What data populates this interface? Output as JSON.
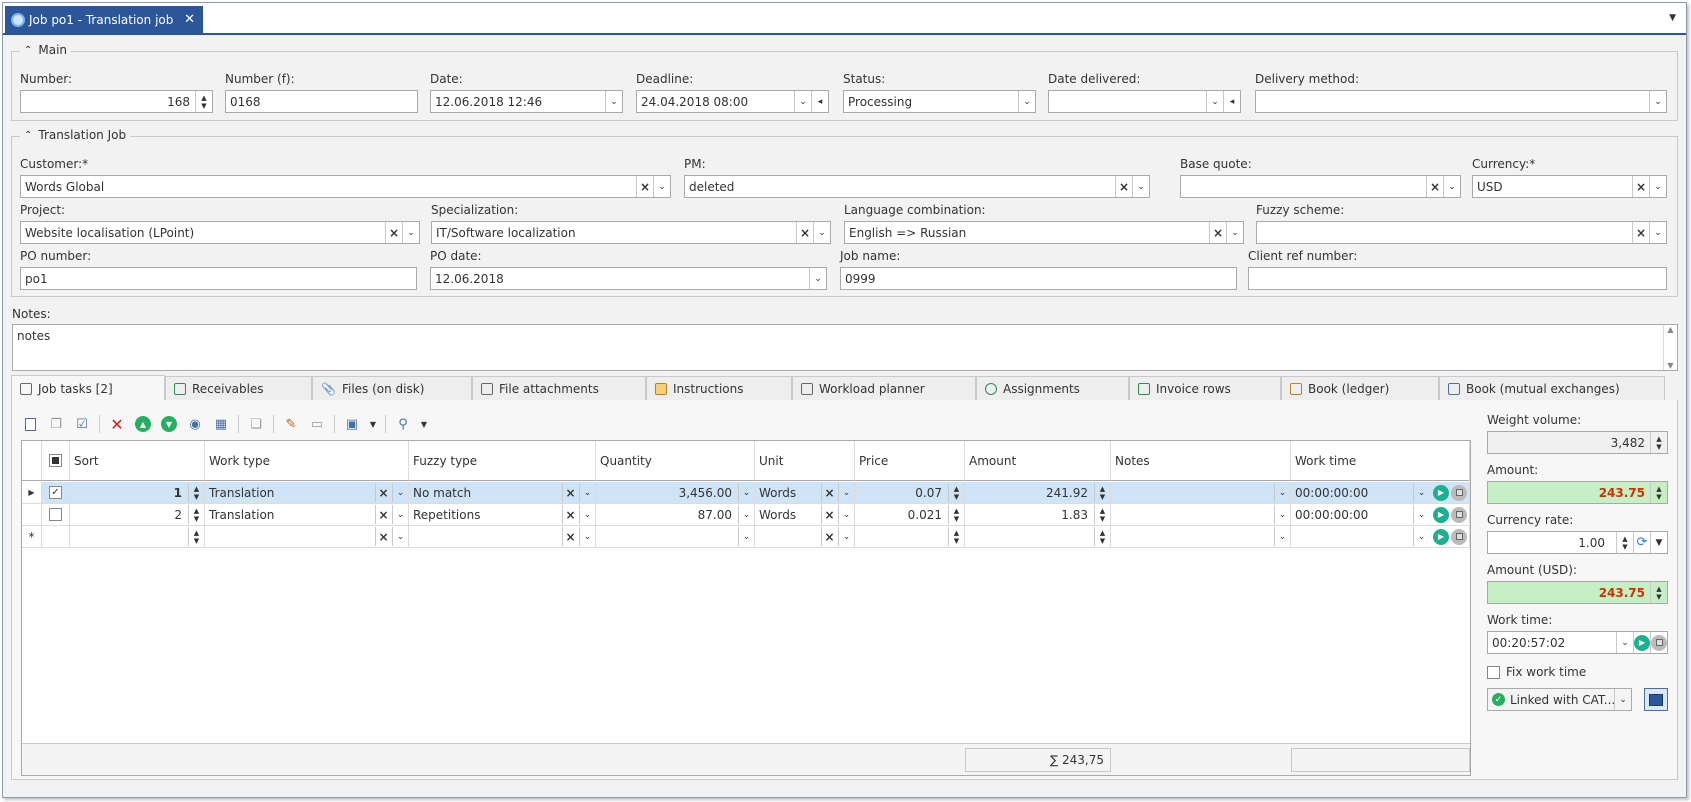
{
  "window": {
    "tab_title": "Job po1 - Translation job",
    "close": "✕"
  },
  "main": {
    "title": "Main",
    "number_label": "Number:",
    "number": "168",
    "number_f_label": "Number (f):",
    "number_f": "0168",
    "date_label": "Date:",
    "date": "12.06.2018 12:46",
    "deadline_label": "Deadline:",
    "deadline": "24.04.2018 08:00",
    "status_label": "Status:",
    "status": "Processing",
    "date_delivered_label": "Date delivered:",
    "date_delivered": "",
    "delivery_method_label": "Delivery method:",
    "delivery_method": ""
  },
  "job": {
    "title": "Translation Job",
    "customer_label": "Customer:*",
    "customer": "Words Global",
    "pm_label": "PM:",
    "pm": "deleted",
    "base_quote_label": "Base quote:",
    "base_quote": "",
    "currency_label": "Currency:*",
    "currency": "USD",
    "project_label": "Project:",
    "project": "Website localisation (LPoint)",
    "specialization_label": "Specialization:",
    "specialization": "IT/Software localization",
    "language_label": "Language combination:",
    "language": "English => Russian",
    "fuzzy_label": "Fuzzy scheme:",
    "fuzzy": "",
    "po_number_label": "PO number:",
    "po_number": "po1",
    "po_date_label": "PO date:",
    "po_date": "12.06.2018",
    "job_name_label": "Job name:",
    "job_name": "0999",
    "client_ref_label": "Client ref number:",
    "client_ref": ""
  },
  "notes": {
    "label": "Notes:",
    "value": "notes"
  },
  "tabs": [
    "Job tasks [2]",
    "Receivables",
    "Files (on disk)",
    "File attachments",
    "Instructions",
    "Workload planner",
    "Assignments",
    "Invoice rows",
    "Book (ledger)",
    "Book (mutual exchanges)"
  ],
  "grid": {
    "headers": [
      "Sort",
      "Work type",
      "Fuzzy type",
      "Quantity",
      "Unit",
      "Price",
      "Amount",
      "Notes",
      "Work time"
    ],
    "rows": [
      {
        "sort": "1",
        "work_type": "Translation",
        "fuzzy_type": "No match",
        "quantity": "3,456.00",
        "unit": "Words",
        "price": "0.07",
        "amount": "241.92",
        "notes": "",
        "work_time": "00:00:00:00"
      },
      {
        "sort": "2",
        "work_type": "Translation",
        "fuzzy_type": "Repetitions",
        "quantity": "87.00",
        "unit": "Words",
        "price": "0.021",
        "amount": "1.83",
        "notes": "",
        "work_time": "00:00:00:00"
      }
    ],
    "new_row_marker": "*",
    "sum": "∑ 243,75"
  },
  "side": {
    "weight_label": "Weight volume:",
    "weight": "3,482",
    "amount_label": "Amount:",
    "amount": "243.75",
    "rate_label": "Currency rate:",
    "rate": "1.00",
    "amount_usd_label": "Amount (USD):",
    "amount_usd": "243.75",
    "work_time_label": "Work time:",
    "work_time": "00:20:57:02",
    "fix_label": "Fix work time",
    "linked": "Linked with CAT..."
  },
  "colors": {
    "accent": "#2b579a",
    "green_fill": "#c6efc6",
    "amount_text": "#d03000",
    "play": "#1bb08f"
  }
}
